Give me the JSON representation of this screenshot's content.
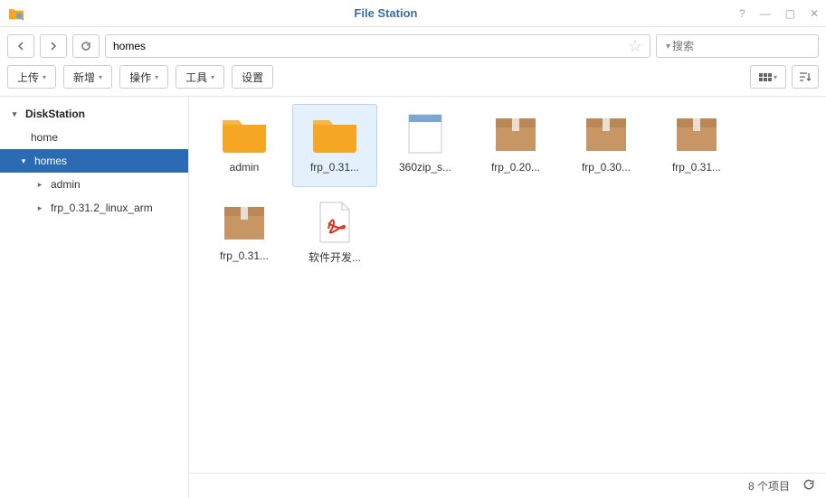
{
  "titlebar": {
    "title": "File Station"
  },
  "navbar": {
    "path": "homes"
  },
  "search": {
    "placeholder": "搜索"
  },
  "toolbar": {
    "upload": "上传",
    "new": "新增",
    "action": "操作",
    "tool": "工具",
    "settings": "设置"
  },
  "sidebar": {
    "root": "DiskStation",
    "items": [
      {
        "label": "home",
        "selected": false
      },
      {
        "label": "homes",
        "selected": true,
        "expanded": true,
        "children": [
          {
            "label": "admin"
          },
          {
            "label": "frp_0.31.2_linux_arm"
          }
        ]
      }
    ]
  },
  "files": [
    {
      "name": "admin",
      "type": "folder",
      "selected": false
    },
    {
      "name": "frp_0.31...",
      "type": "folder",
      "selected": true
    },
    {
      "name": "360zip_s...",
      "type": "doc",
      "selected": false
    },
    {
      "name": "frp_0.20...",
      "type": "archive",
      "selected": false
    },
    {
      "name": "frp_0.30...",
      "type": "archive",
      "selected": false
    },
    {
      "name": "frp_0.31...",
      "type": "archive",
      "selected": false
    },
    {
      "name": "frp_0.31...",
      "type": "archive",
      "selected": false
    },
    {
      "name": "软件开发...",
      "type": "pdf",
      "selected": false
    }
  ],
  "status": {
    "count_label": "8 个项目"
  }
}
